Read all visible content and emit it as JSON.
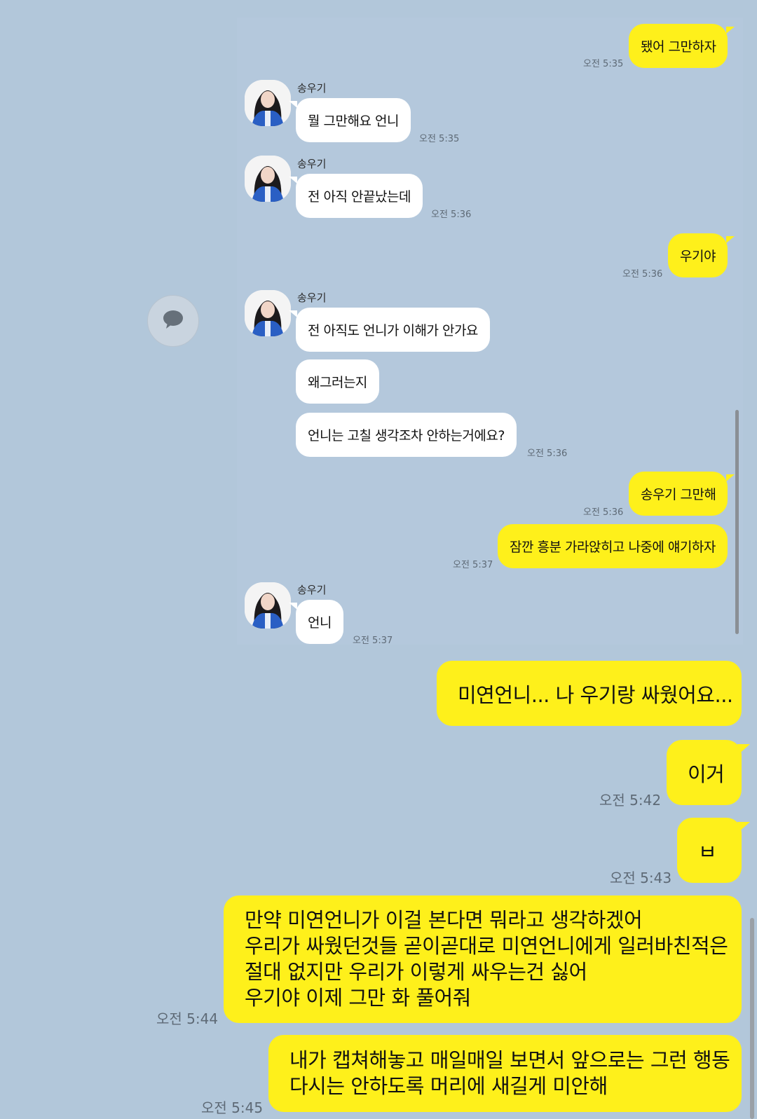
{
  "chat_partner_name": "송우기",
  "screenshot_messages": [
    {
      "sender": "me",
      "text": "됐어 그만하자",
      "time": "오전 5:35"
    },
    {
      "sender": "other",
      "text": "뭘 그만해요 언니",
      "time": "오전 5:35"
    },
    {
      "sender": "other",
      "text": "전 아직 안끝났는데",
      "time": "오전 5:36"
    },
    {
      "sender": "me",
      "text": "우기야",
      "time": "오전 5:36"
    },
    {
      "sender": "other",
      "text": "전 아직도 언니가 이해가 안가요"
    },
    {
      "sender": "other",
      "text": "왜그러는지"
    },
    {
      "sender": "other",
      "text": "언니는 고칠 생각조차 안하는거에요?",
      "time": "오전 5:36"
    },
    {
      "sender": "me",
      "text": "송우기 그만해",
      "time": "오전 5:36"
    },
    {
      "sender": "me",
      "text": "잠깐 흥분 가라앉히고 나중에 얘기하자",
      "time": "오전 5:37"
    },
    {
      "sender": "other",
      "text": "언니",
      "time": "오전 5:37"
    }
  ],
  "messages": [
    {
      "text": "미연언니... 나 우기랑 싸웠어요..."
    },
    {
      "text": "이거",
      "time": "오전 5:42"
    },
    {
      "text": "ㅂ",
      "time": "오전 5:43"
    },
    {
      "lines": [
        "만약 미연언니가 이걸 본다면 뭐라고 생각하겠어",
        "우리가 싸웠던것들 곧이곧대로 미연언니에게 일러바친적은",
        "절대 없지만 우리가 이렇게 싸우는건 싫어",
        "우기야 이제 그만 화 풀어줘"
      ],
      "time": "오전 5:44"
    },
    {
      "lines": [
        "내가 캡쳐해놓고 매일매일 보면서 앞으로는 그런 행동",
        "다시는 안하도록 머리에 새길게 미안해"
      ],
      "time": "오전 5:45"
    }
  ],
  "icons": {
    "share": "speech-bubble-icon"
  },
  "colors": {
    "background": "#b2c7da",
    "my_bubble": "#fef01b",
    "other_bubble": "#ffffff"
  }
}
